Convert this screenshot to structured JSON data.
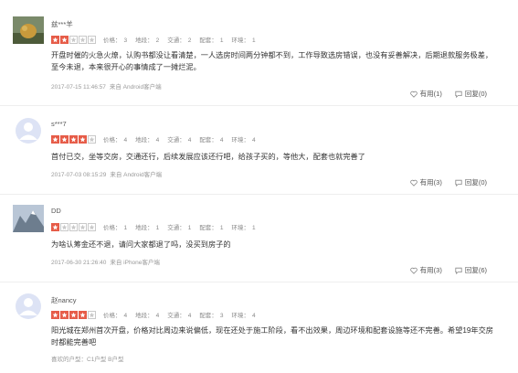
{
  "reviews": [
    {
      "username": "兹***羊",
      "stars": 2,
      "scores": [
        {
          "label": "价格：",
          "value": "3"
        },
        {
          "label": "地段：",
          "value": "2"
        },
        {
          "label": "交通：",
          "value": "2"
        },
        {
          "label": "配套：",
          "value": "1"
        },
        {
          "label": "环境：",
          "value": "1"
        }
      ],
      "content": "开盘时催的火急火燎，认购书都没让看清楚，一人选房时间两分钟都不到，工作导致选房错误，也没有妥善解决，后期退款服务极差，至今未退，本来很开心的事情成了一摊烂泥。",
      "time": "2017-07-15 11:46:57",
      "source": "来自 Android客户端",
      "useful": "有用(1)",
      "reply": "回复(0)"
    },
    {
      "username": "s***7",
      "stars": 4,
      "scores": [
        {
          "label": "价格：",
          "value": "4"
        },
        {
          "label": "地段：",
          "value": "4"
        },
        {
          "label": "交通：",
          "value": "4"
        },
        {
          "label": "配套：",
          "value": "4"
        },
        {
          "label": "环境：",
          "value": "4"
        }
      ],
      "content": "首付已交，坐等交房，交通还行，后续发展应该还行吧，给孩子买的，等他大，配套也就完善了",
      "time": "2017-07-03 08:15:29",
      "source": "来自 Android客户端",
      "useful": "有用(3)",
      "reply": "回复(0)"
    },
    {
      "username": "DD",
      "stars": 1,
      "scores": [
        {
          "label": "价格：",
          "value": "1"
        },
        {
          "label": "地段：",
          "value": "1"
        },
        {
          "label": "交通：",
          "value": "1"
        },
        {
          "label": "配套：",
          "value": "1"
        },
        {
          "label": "环境：",
          "value": "1"
        }
      ],
      "content": "为啥认筹金还不退，请问大家都退了吗，没买到房子的",
      "time": "2017-06-30 21:26:40",
      "source": "来自 iPhone客户端",
      "useful": "有用(3)",
      "reply": "回复(6)"
    },
    {
      "username": "赵nancy",
      "stars": 4,
      "scores": [
        {
          "label": "价格：",
          "value": "4"
        },
        {
          "label": "地段：",
          "value": "4"
        },
        {
          "label": "交通：",
          "value": "4"
        },
        {
          "label": "配套：",
          "value": "3"
        },
        {
          "label": "环境：",
          "value": "4"
        }
      ],
      "content": "阳光城在郑州首次开盘，价格对比周边来说偏低，现在还处于施工阶段，看不出效果，周边环境和配套设施等还不完善。希望19年交房时都能完善吧",
      "interested_label": "喜欢的户型：",
      "interested": "C1户型  B户型"
    }
  ],
  "colors": {
    "star": "#e65c48",
    "star_empty": "#c9c9c9"
  }
}
